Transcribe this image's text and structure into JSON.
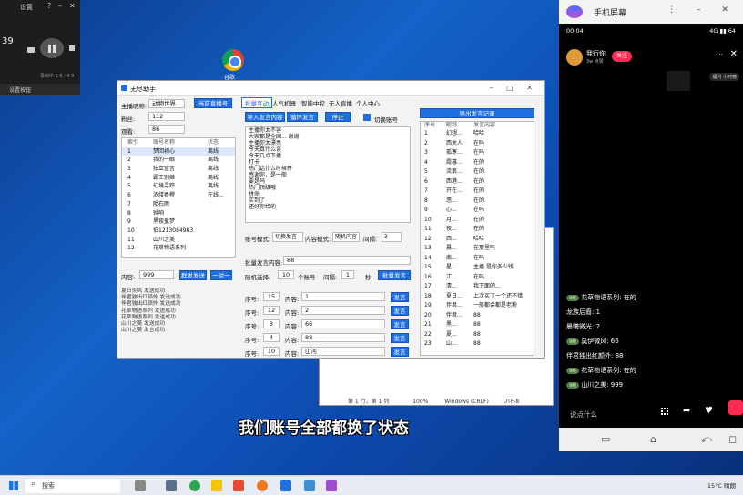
{
  "recorder": {
    "title": "设置",
    "help": "?",
    "minimize": "–",
    "close": "✕",
    "timer": "39",
    "info": "录制中 1 6 : 4 9",
    "footer": "设置按钮"
  },
  "desktop": {
    "chrome_label": "谷歌"
  },
  "app": {
    "title": "无尽助手",
    "window_controls": "–  □  ✕",
    "fields": {
      "room_label": "主播昵称:",
      "room_value": "动物世界",
      "fans_label": "粉丝:",
      "fans_value": "112",
      "watch_label": "观看:",
      "watch_value": "86"
    },
    "switch_button": "当前直播号",
    "account_table": {
      "headers": [
        "索引",
        "账号名称",
        "状态"
      ],
      "rows": [
        [
          "1",
          "梦回初心",
          "离线"
        ],
        [
          "2",
          "我的一眼",
          "离线"
        ],
        [
          "3",
          "独立宣言",
          "离线"
        ],
        [
          "4",
          "霸王别姬",
          "离线"
        ],
        [
          "5",
          "幻境寻踪",
          "离线"
        ],
        [
          "6",
          "浓缕香橙",
          "在线..."
        ],
        [
          "7",
          "陨石雨",
          ""
        ],
        [
          "8",
          "钟响",
          ""
        ],
        [
          "9",
          "黑夜童梦",
          ""
        ],
        [
          "10",
          "伯1213084983",
          ""
        ],
        [
          "11",
          "山川之美",
          ""
        ],
        [
          "12",
          "花草物语系列",
          ""
        ]
      ]
    },
    "content_label": "内容:",
    "content_value": "999",
    "send_all_button": "群发发送",
    "one_by_one_button": "一对一",
    "log": [
      "夏日炎风 发送成功",
      "伴君独出红颜外 发送成功",
      "伴君独出红颜外 发送成功",
      "花草物语系列 发送成功",
      "花草物语系列 发送成功",
      "山川之美 发送成功",
      "山川之美 发言成功"
    ],
    "tabs": [
      "批量互动",
      "人气机器",
      "智能中控",
      "无人直播",
      "个人中心"
    ],
    "import_button": "导入发言内容",
    "loop_button": "循环发言",
    "stop_button": "停止",
    "checkbox_label": "切换账号",
    "messages": [
      "主播你太不容",
      "大家都是全国... 谢谢",
      "主播你太漂亮",
      "今天真什么谈",
      "今天几点下播",
      "打卡",
      "热门话什么时候开",
      "感谢你，是一般",
      "要是吗",
      "热门顶级哦",
      "拼命",
      "买到了",
      "还好你给的"
    ],
    "account_mode_label": "账号模式:",
    "account_mode_value": "切换发言",
    "content_mode_label": "内容模式:",
    "content_mode_value": "随机内容",
    "interval_label": "间隔:",
    "interval_value": "3",
    "batch_label": "批量发言内容:",
    "batch_value": "88",
    "random_label": "随机选择:",
    "random_value": "10",
    "random_unit": "个账号",
    "interval2_label": "间隔:",
    "interval2_value": "1",
    "interval2_unit": "秒",
    "batch_send_button": "批量发言",
    "seq_rows": [
      {
        "seq_label": "序号:",
        "seq": "15",
        "content_label": "内容:",
        "content": "1",
        "button": "发言"
      },
      {
        "seq_label": "序号:",
        "seq": "12",
        "content_label": "内容:",
        "content": "2",
        "button": "发言"
      },
      {
        "seq_label": "序号:",
        "seq": "3",
        "content_label": "内容:",
        "content": "66",
        "button": "发言"
      },
      {
        "seq_label": "序号:",
        "seq": "4",
        "content_label": "内容:",
        "content": "88",
        "button": "发言"
      },
      {
        "seq_label": "序号:",
        "seq": "10",
        "content_label": "内容:",
        "content": "山河",
        "button": "发言"
      }
    ],
    "export_button": "导出发言记录",
    "record_table": {
      "headers": [
        "序号",
        "昵称",
        "发言内容"
      ],
      "rows": [
        [
          "1",
          "幻想...",
          "哈哈"
        ],
        [
          "2",
          "西关人",
          "在吗"
        ],
        [
          "3",
          "孤寒...",
          "在吗"
        ],
        [
          "4",
          "霞暮...",
          "在的"
        ],
        [
          "5",
          "流浪...",
          "在的"
        ],
        [
          "6",
          "西港...",
          "在的"
        ],
        [
          "7",
          "开在...",
          "在的"
        ],
        [
          "8",
          "悠...",
          "在的"
        ],
        [
          "9",
          "心...",
          "在吗"
        ],
        [
          "10",
          "月...",
          "在的"
        ],
        [
          "11",
          "夜...",
          "在的"
        ],
        [
          "12",
          "西...",
          "哈哈"
        ],
        [
          "13",
          "晨...",
          "在那里吗"
        ],
        [
          "14",
          "南...",
          "在吗"
        ],
        [
          "15",
          "星...",
          "主播 是你多少钱"
        ],
        [
          "16",
          "江...",
          "在吗"
        ],
        [
          "17",
          "清...",
          "我下面的..."
        ],
        [
          "18",
          "夏日...",
          "上次买了一个还不错"
        ],
        [
          "19",
          "伴君...",
          "一般都会都是老粉"
        ],
        [
          "20",
          "伴君...",
          "88"
        ],
        [
          "21",
          "黑...",
          "88"
        ],
        [
          "22",
          "夏...",
          "88"
        ],
        [
          "23",
          "山...",
          "88"
        ]
      ]
    }
  },
  "statusbar": {
    "pos": "第 1 行，第 1 列",
    "zoom": "100%",
    "eol": "Windows (CRLF)",
    "enc": "UTF-8"
  },
  "phone": {
    "app_name": "手机屏幕",
    "window_controls": "⋮  –  ✕",
    "status_time": "00:04",
    "status_right": "4G ▮▮ 64",
    "host_name": "我行你",
    "host_likes": "3w 点赞",
    "follow": "关注",
    "rank_text": "福利 小时榜",
    "comments": [
      {
        "badge": "9级",
        "user": "花草物语系列:",
        "text": " 在的"
      },
      {
        "badge": "",
        "user": "龙族后裔:",
        "text": " 1"
      },
      {
        "badge": "",
        "user": "晨曦微光:",
        "text": " 2"
      },
      {
        "badge": "9级",
        "user": "莫伊微风:",
        "text": " 66"
      },
      {
        "badge": "",
        "user": "伴君独出红颜外:",
        "text": " 88"
      },
      {
        "badge": "9级",
        "user": "花草物语系列:",
        "text": " 在的"
      },
      {
        "badge": "9级",
        "user": "山川之美:",
        "text": " 999"
      }
    ],
    "say_placeholder": "说点什么",
    "nav": [
      "▭",
      "⌂",
      "⤺",
      "◻"
    ]
  },
  "subtitle": "我们账号全部都换了状态",
  "taskbar": {
    "search_placeholder": "搜索",
    "tray": "15°C  晴朗"
  },
  "colors": {
    "accent": "#1f6fe0",
    "phone_follow": "#fe2c55",
    "badge": "#4b7b3f"
  }
}
